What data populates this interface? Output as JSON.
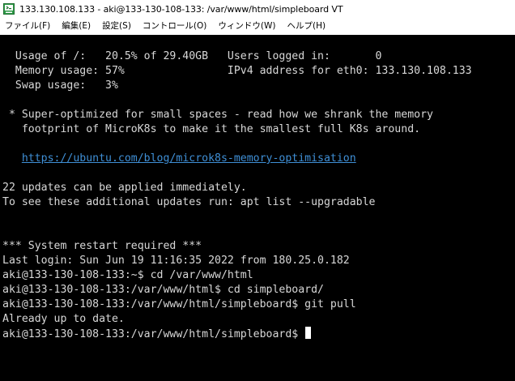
{
  "window": {
    "title": "133.130.108.133 - aki@133-130-108-133: /var/www/html/simpleboard VT"
  },
  "menu": {
    "items": [
      "ファイル(F)",
      "編集(E)",
      "設定(S)",
      "コントロール(O)",
      "ウィンドウ(W)",
      "ヘルプ(H)"
    ]
  },
  "terminal": {
    "lines": [
      "  Usage of /:   20.5% of 29.40GB   Users logged in:       0",
      "  Memory usage: 57%                IPv4 address for eth0: 133.130.108.133",
      "  Swap usage:   3%",
      "",
      " * Super-optimized for small spaces - read how we shrank the memory",
      "   footprint of MicroK8s to make it the smallest full K8s around.",
      "",
      "   https://ubuntu.com/blog/microk8s-memory-optimisation",
      "",
      "22 updates can be applied immediately.",
      "To see these additional updates run: apt list --upgradable",
      "",
      "",
      "*** System restart required ***",
      "Last login: Sun Jun 19 11:16:35 2022 from 180.25.0.182",
      "aki@133-130-108-133:~$ cd /var/www/html",
      "aki@133-130-108-133:/var/www/html$ cd simpleboard/",
      "aki@133-130-108-133:/var/www/html/simpleboard$ git pull",
      "Already up to date."
    ],
    "link_prefix": "   ",
    "link_text": "https://ubuntu.com/blog/microk8s-memory-optimisation",
    "prompt": "aki@133-130-108-133:/var/www/html/simpleboard$ "
  },
  "colors": {
    "terminal_background": "#000000",
    "terminal_text": "#d8d8d8",
    "link": "#3f8fd6",
    "cursor": "#ffffff"
  },
  "icons": {
    "app": "teraterm-icon"
  }
}
